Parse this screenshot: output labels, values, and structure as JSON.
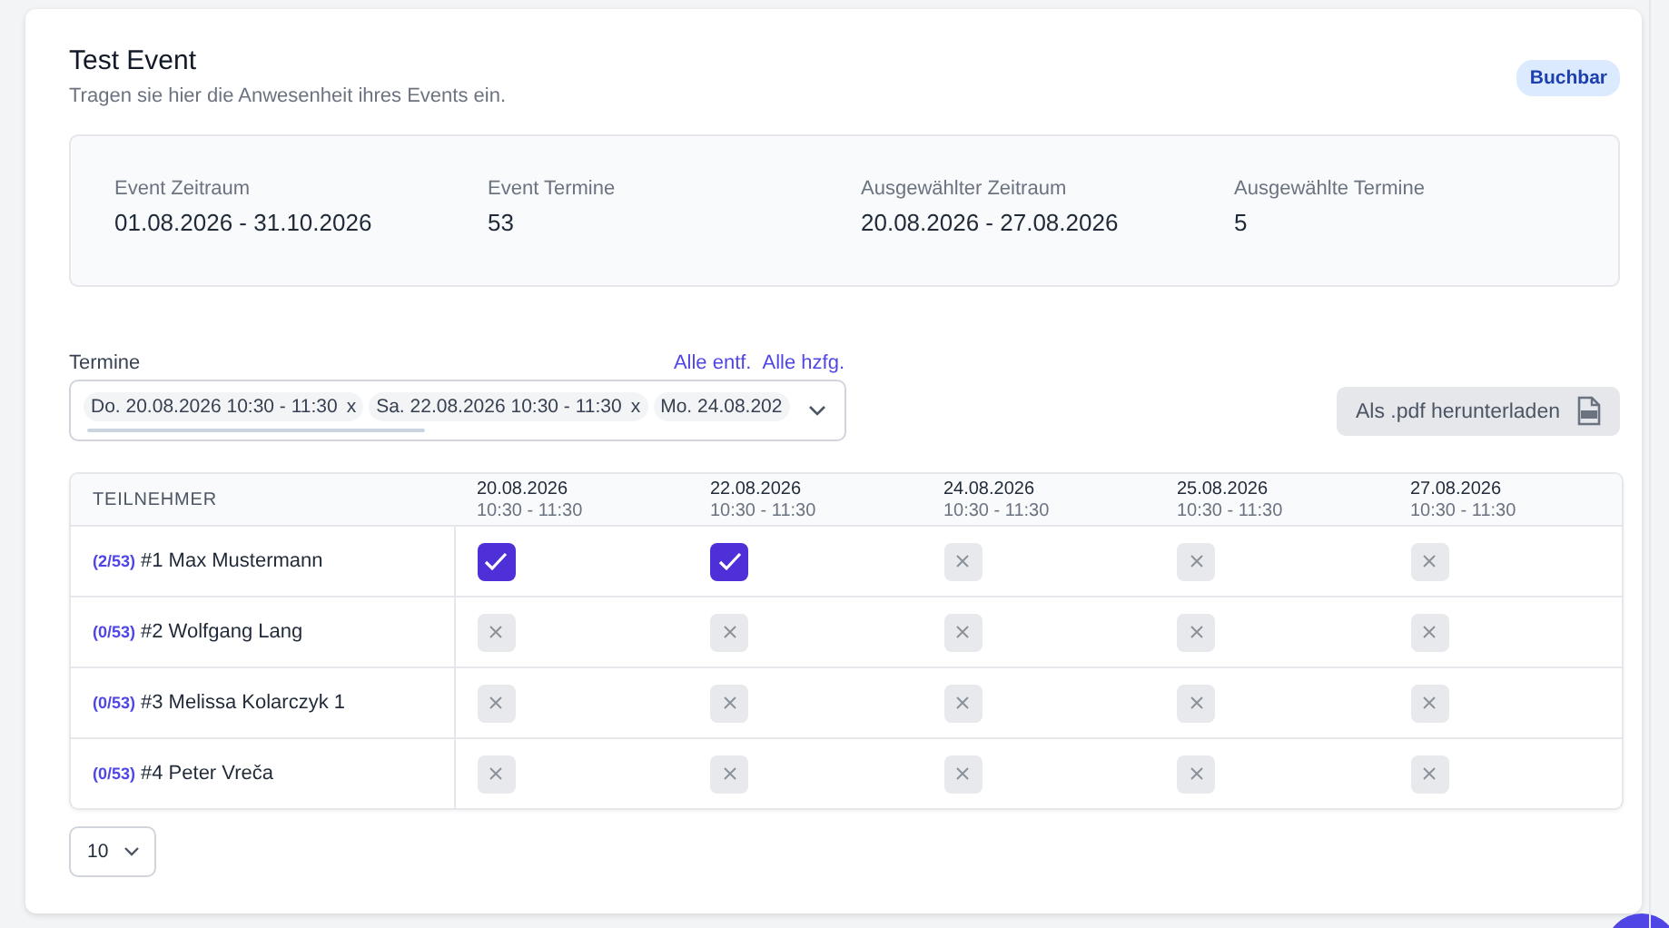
{
  "header": {
    "title": "Test Event",
    "subtitle": "Tragen sie hier die Anwesenheit ihres Events ein.",
    "badge": "Buchbar"
  },
  "stats": [
    {
      "label": "Event Zeitraum",
      "value": "01.08.2026 - 31.10.2026"
    },
    {
      "label": "Event Termine",
      "value": "53"
    },
    {
      "label": "Ausgewählter Zeitraum",
      "value": "20.08.2026 - 27.08.2026"
    },
    {
      "label": "Ausgewählte Termine",
      "value": "5"
    }
  ],
  "termine": {
    "label": "Termine",
    "actions": [
      "Alle entf.",
      "Alle hzfg."
    ],
    "chips": [
      {
        "text": "Do. 20.08.2026 10:30 - 11:30",
        "remove": "x"
      },
      {
        "text": "Sa. 22.08.2026 10:30 - 11:30",
        "remove": "x"
      },
      {
        "text": "Mo. 24.08.202"
      }
    ]
  },
  "download_button": "Als .pdf herunterladen",
  "table": {
    "first_column": "TEILNEHMER",
    "columns": [
      {
        "date": "20.08.2026",
        "time": "10:30 - 11:30"
      },
      {
        "date": "22.08.2026",
        "time": "10:30 - 11:30"
      },
      {
        "date": "24.08.2026",
        "time": "10:30 - 11:30"
      },
      {
        "date": "25.08.2026",
        "time": "10:30 - 11:30"
      },
      {
        "date": "27.08.2026",
        "time": "10:30 - 11:30"
      }
    ],
    "rows": [
      {
        "count": "(2/53)",
        "name": "#1 Max Mustermann",
        "attendance": [
          {
            "kind": "present"
          },
          {
            "kind": "present"
          },
          {
            "kind": "absent"
          },
          {
            "kind": "absent"
          },
          {
            "kind": "absent"
          }
        ]
      },
      {
        "count": "(0/53)",
        "name": "#2 Wolfgang Lang",
        "attendance": [
          {
            "kind": "absent"
          },
          {
            "kind": "absent"
          },
          {
            "kind": "absent"
          },
          {
            "kind": "absent"
          },
          {
            "kind": "absent"
          }
        ]
      },
      {
        "count": "(0/53)",
        "name": "#3 Melissa Kolarczyk 1",
        "attendance": [
          {
            "kind": "absent"
          },
          {
            "kind": "absent"
          },
          {
            "kind": "absent"
          },
          {
            "kind": "absent"
          },
          {
            "kind": "absent"
          }
        ]
      },
      {
        "count": "(0/53)",
        "name": "#4 Peter Vreča",
        "attendance": [
          {
            "kind": "absent"
          },
          {
            "kind": "absent"
          },
          {
            "kind": "absent"
          },
          {
            "kind": "absent"
          },
          {
            "kind": "absent"
          }
        ]
      }
    ]
  },
  "page_size": "10"
}
